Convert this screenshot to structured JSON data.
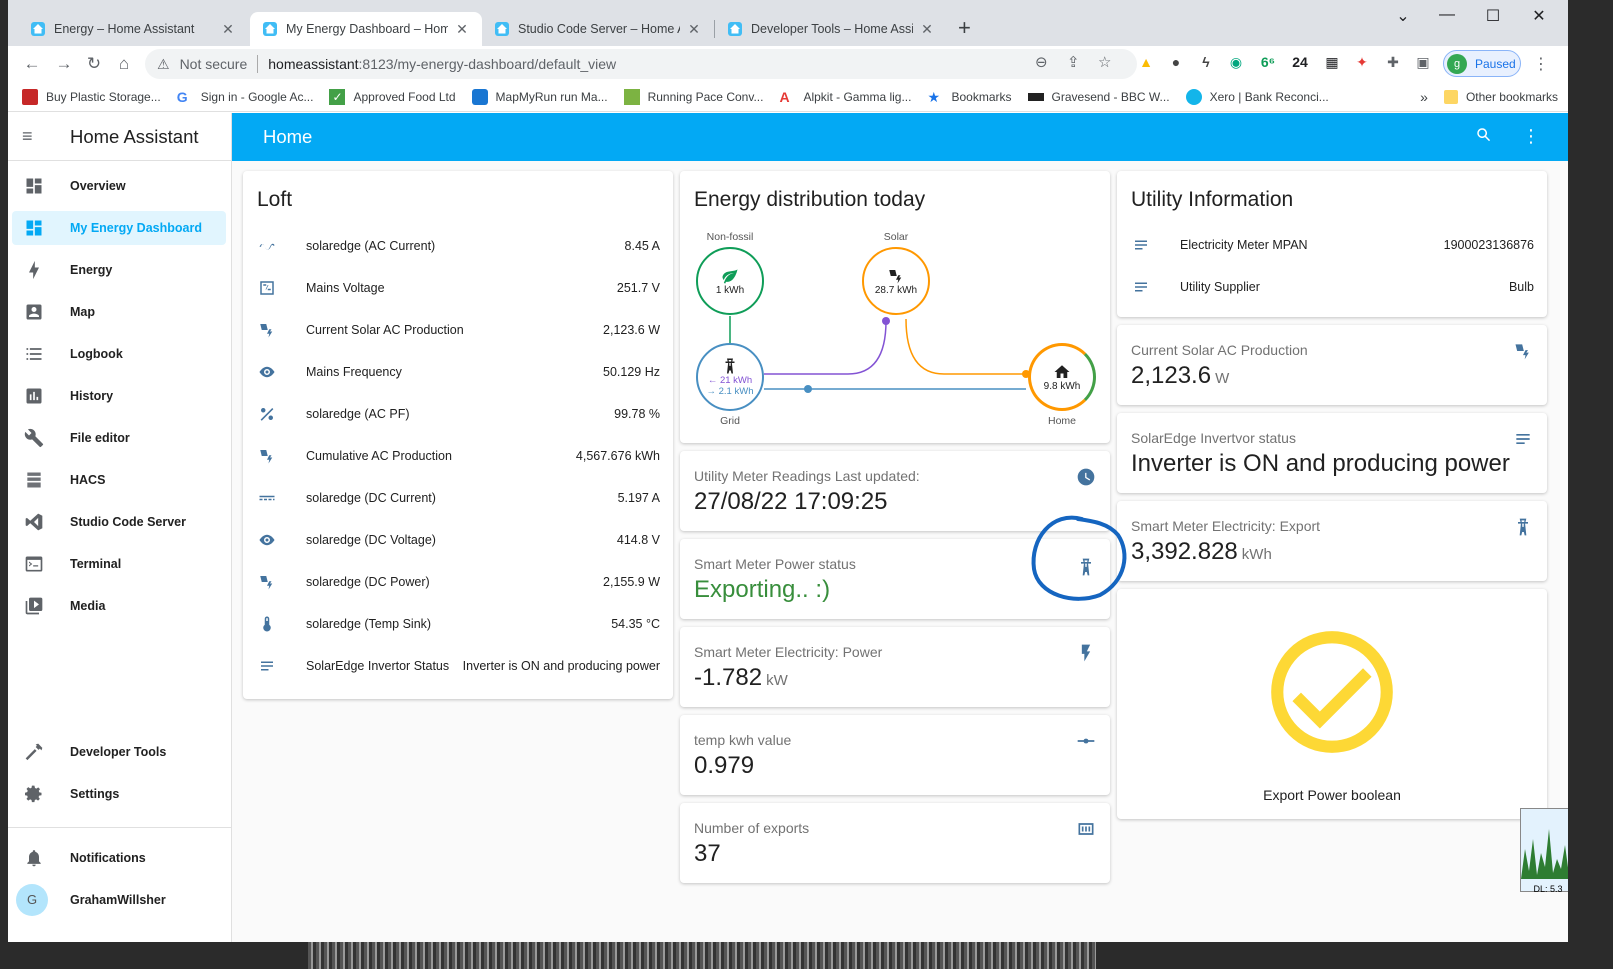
{
  "browser": {
    "tabs": [
      {
        "title": "Energy – Home Assistant",
        "active": false
      },
      {
        "title": "My Energy Dashboard – Home A",
        "active": true
      },
      {
        "title": "Studio Code Server – Home Assis",
        "active": false
      },
      {
        "title": "Developer Tools – Home Assistar",
        "active": false
      }
    ],
    "address": {
      "security_label": "Not secure",
      "host": "homeassistant",
      "path": ":8123/my-energy-dashboard/default_view"
    },
    "extensions": [
      "6⁶",
      "24"
    ],
    "profile": {
      "initial": "g",
      "status": "Paused"
    },
    "bookmarks": [
      "Buy Plastic Storage...",
      "Sign in - Google Ac...",
      "Approved Food Ltd",
      "MapMyRun run Ma...",
      "Running Pace Conv...",
      "Alpkit - Gamma lig...",
      "Bookmarks",
      "Gravesend - BBC W...",
      "Xero | Bank Reconci..."
    ],
    "bookmarks_overflow": "»",
    "other_bookmarks": "Other bookmarks"
  },
  "sidebar": {
    "title": "Home Assistant",
    "items": [
      {
        "label": "Overview"
      },
      {
        "label": "My Energy Dashboard"
      },
      {
        "label": "Energy"
      },
      {
        "label": "Map"
      },
      {
        "label": "Logbook"
      },
      {
        "label": "History"
      },
      {
        "label": "File editor"
      },
      {
        "label": "HACS"
      },
      {
        "label": "Studio Code Server"
      },
      {
        "label": "Terminal"
      },
      {
        "label": "Media"
      }
    ],
    "bottom_items": [
      {
        "label": "Developer Tools"
      },
      {
        "label": "Settings"
      }
    ],
    "notifications_label": "Notifications",
    "user": {
      "initial": "G",
      "name": "GrahamWillsher"
    }
  },
  "header": {
    "title": "Home"
  },
  "loft": {
    "title": "Loft",
    "rows": [
      {
        "icon": "current-ac-icon",
        "name": "solaredge (AC Current)",
        "value": "8.45 A"
      },
      {
        "icon": "voltage-icon",
        "name": "Mains Voltage",
        "value": "251.7 V"
      },
      {
        "icon": "solar-power-icon",
        "name": "Current Solar AC Production",
        "value": "2,123.6 W"
      },
      {
        "icon": "eye-icon",
        "name": "Mains Frequency",
        "value": "50.129 Hz"
      },
      {
        "icon": "percent-icon",
        "name": "solaredge (AC PF)",
        "value": "99.78 %"
      },
      {
        "icon": "solar-power-icon",
        "name": "Cumulative AC Production",
        "value": "4,567.676 kWh"
      },
      {
        "icon": "current-dc-icon",
        "name": "solaredge (DC Current)",
        "value": "5.197 A"
      },
      {
        "icon": "eye-icon",
        "name": "solaredge (DC Voltage)",
        "value": "414.8 V"
      },
      {
        "icon": "solar-power-icon",
        "name": "solaredge (DC Power)",
        "value": "2,155.9 W"
      },
      {
        "icon": "thermometer-icon",
        "name": "solaredge (Temp Sink)",
        "value": "54.35 °C"
      },
      {
        "icon": "text-icon",
        "name": "SolarEdge Invertor Status",
        "value": "Inverter is ON and producing power"
      }
    ]
  },
  "energy_distribution": {
    "title": "Energy distribution today",
    "nonfossil": {
      "label": "Non-fossil",
      "value": "1 kWh"
    },
    "solar": {
      "label": "Solar",
      "value": "28.7 kWh"
    },
    "grid": {
      "label": "Grid",
      "import": "← 21 kWh",
      "export": "→ 2.1 kWh"
    },
    "home": {
      "label": "Home",
      "value": "9.8 kWh"
    },
    "colors": {
      "nonfossil": "#0f9d58",
      "solar": "#ff9800",
      "grid": "#488fc2",
      "grid_export": "#8353d4",
      "home": "#ff9800"
    }
  },
  "utility_meter": {
    "label": "Utility Meter Readings Last updated:",
    "value": "27/08/22 17:09:25"
  },
  "smart_meter_status": {
    "label": "Smart Meter Power status",
    "value": "Exporting.. :)",
    "color": "#388e3c"
  },
  "smart_meter_power": {
    "label": "Smart Meter Electricity: Power",
    "value": "-1.782",
    "unit": "kW"
  },
  "temp_kwh": {
    "label": "temp kwh value",
    "value": "0.979"
  },
  "exports": {
    "label": "Number of exports",
    "value": "37"
  },
  "utility_info": {
    "title": "Utility Information",
    "rows": [
      {
        "name": "Electricity Meter MPAN",
        "value": "1900023136876"
      },
      {
        "name": "Utility Supplier",
        "value": "Bulb"
      }
    ]
  },
  "solar_production": {
    "label": "Current Solar AC Production",
    "value": "2,123.6",
    "unit": "W"
  },
  "inverter_status": {
    "label": "SolarEdge Invertvor status",
    "value": "Inverter is ON and producing power"
  },
  "export_meter": {
    "label": "Smart Meter Electricity: Export",
    "value": "3,392.828",
    "unit": "kWh"
  },
  "export_boolean": {
    "label": "Export Power boolean",
    "color": "#fdd835"
  },
  "annotation_color": "#1565c0",
  "overlay": {
    "label": "DL: 5.3"
  }
}
